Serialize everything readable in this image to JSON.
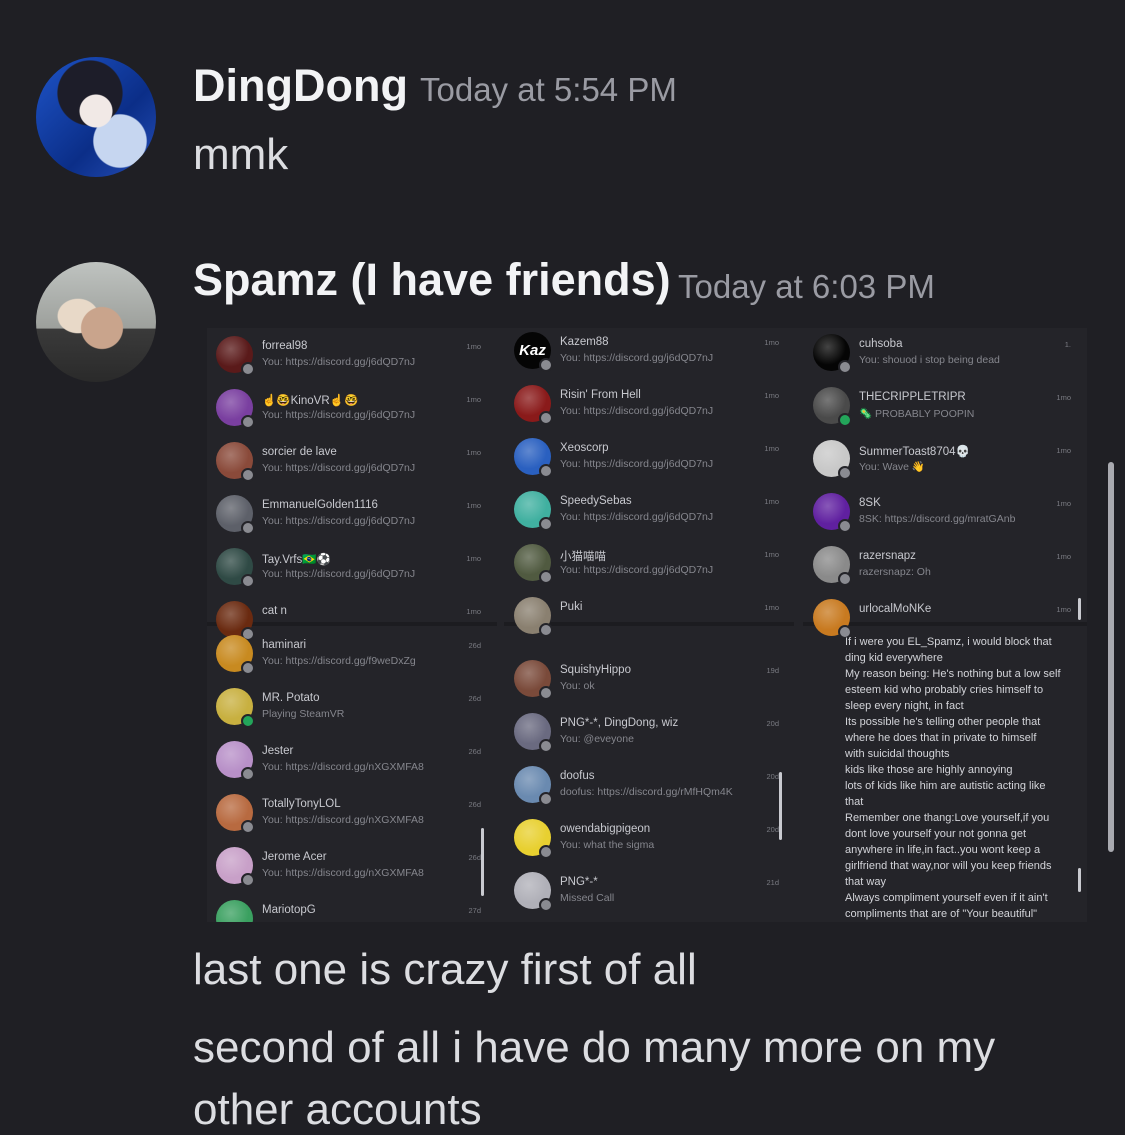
{
  "messages": [
    {
      "username": "DingDong",
      "timestamp": "Today at 5:54 PM",
      "lines": [
        "mmk"
      ]
    },
    {
      "username": "Spamz (I have friends)",
      "timestamp": "Today at 6:03 PM",
      "lines": [
        "last one is crazy first of all",
        "second of all i have do many more on my",
        "other accounts"
      ]
    }
  ],
  "attachment": {
    "column1_top": [
      {
        "name": "forreal98",
        "sub": "You: https://discord.gg/j6dQD7nJ",
        "time": "1mo",
        "color": "#5a1a1a"
      },
      {
        "name": "☝️🤓KinoVR☝️🤓",
        "sub": "You: https://discord.gg/j6dQD7nJ",
        "time": "1mo",
        "color": "#7a3fa0"
      },
      {
        "name": "sorcier de lave",
        "sub": "You: https://discord.gg/j6dQD7nJ",
        "time": "1mo",
        "color": "#8a4a3a"
      },
      {
        "name": "EmmanuelGolden1116",
        "sub": "You: https://discord.gg/j6dQD7nJ",
        "time": "1mo",
        "color": "#5d6069"
      },
      {
        "name": "Tay.Vrfs🇧🇷⚽",
        "sub": "You: https://discord.gg/j6dQD7nJ",
        "time": "1mo",
        "color": "#2f4a45"
      },
      {
        "name": "cat n",
        "sub": "",
        "time": "1mo",
        "color": "#6a2a10"
      }
    ],
    "column1_bottom": [
      {
        "name": "haminari",
        "sub": "You: https://discord.gg/f9weDxZg",
        "time": "26d",
        "color": "#c88a20"
      },
      {
        "name": "MR. Potato",
        "sub": "Playing SteamVR",
        "time": "26d",
        "color": "#c8b040",
        "online": true
      },
      {
        "name": "Jester",
        "sub": "You: https://discord.gg/nXGXMFA8",
        "time": "26d",
        "color": "#b890c8"
      },
      {
        "name": "TotallyTonyLOL",
        "sub": "You: https://discord.gg/nXGXMFA8",
        "time": "26d",
        "color": "#b86a40"
      },
      {
        "name": "Jerome Acer",
        "sub": "You: https://discord.gg/nXGXMFA8",
        "time": "26d",
        "color": "#c8a0c8"
      },
      {
        "name": "MariotopG",
        "sub": "",
        "time": "27d",
        "color": "#3aa060"
      }
    ],
    "column2_top": [
      {
        "name": "Kazem88",
        "sub": "You: https://discord.gg/j6dQD7nJ",
        "time": "1mo",
        "kaz": "Kaz"
      },
      {
        "name": "Risin' From Hell",
        "sub": "You: https://discord.gg/j6dQD7nJ",
        "time": "1mo",
        "color": "#8a1a1a"
      },
      {
        "name": "Xeoscorp",
        "sub": "You: https://discord.gg/j6dQD7nJ",
        "time": "1mo",
        "color": "#2a60c0"
      },
      {
        "name": "SpeedySebas",
        "sub": "You: https://discord.gg/j6dQD7nJ",
        "time": "1mo",
        "color": "#40b0a0"
      },
      {
        "name": "小猫喵喵",
        "sub": "You: https://discord.gg/j6dQD7nJ",
        "time": "1mo",
        "color": "#505a40"
      },
      {
        "name": "Puki",
        "sub": "",
        "time": "1mo",
        "color": "#8a8070"
      }
    ],
    "column2_bottom": [
      {
        "name": "SquishyHippo",
        "sub": "You: ok",
        "time": "19d",
        "color": "#7a4a3a"
      },
      {
        "name": "PNG*-*, DingDong, wiz",
        "sub": "You: @eveyone",
        "time": "20d",
        "color": "#6a6a80"
      },
      {
        "name": "doofus",
        "sub": "doofus: https://discord.gg/rMfHQm4K",
        "time": "20d",
        "color": "#6a8ab0"
      },
      {
        "name": "owendabigpigeon",
        "sub": "You: what the sigma",
        "time": "20d",
        "color": "#e8d030"
      },
      {
        "name": "PNG*-*",
        "sub": "Missed Call",
        "time": "21d",
        "color": "#b0b0b8"
      }
    ],
    "column3_top": [
      {
        "name": "cuhsoba",
        "sub": "You: shouod i stop being dead",
        "time": "1.",
        "color": "#050505"
      },
      {
        "name": "THECRIPPLETRIPR",
        "sub": "🦠 PROBABLY POOPIN",
        "time": "1mo",
        "color": "#4a4a4a",
        "online": true
      },
      {
        "name": "SummerToast8704💀",
        "sub": "You: Wave 👋",
        "time": "1mo",
        "color": "#c8c8c8"
      },
      {
        "name": "8SK",
        "sub": "8SK: https://discord.gg/mratGAnb",
        "time": "1mo",
        "color": "#6020a0"
      },
      {
        "name": "razersnapz",
        "sub": "razersnapz: Oh",
        "time": "1mo",
        "color": "#8a8a8a"
      },
      {
        "name": "urlocalMoNKe",
        "sub": "",
        "time": "1mo",
        "color": "#c87a20"
      }
    ],
    "column3_quote": [
      "If i were you EL_Spamz, i would block that",
      "ding kid everywhere",
      "My reason being: He's nothing but a low self",
      "esteem kid who probably cries himself to",
      "sleep every night, in fact",
      "Its possible he's telling other people that",
      "where he does that in private to himself",
      "with suicidal thoughts",
      "kids like those are highly annoying",
      "lots of kids like him are autistic acting like",
      "that",
      "Remember one thang:Love yourself,if you",
      "dont love yourself your not gonna get",
      "anywhere in life,in fact..you wont keep a",
      "girlfriend that way,nor will you keep friends",
      "that way",
      "Always compliment yourself even if it ain't",
      "compliments that are of \"Your beautiful\""
    ]
  }
}
